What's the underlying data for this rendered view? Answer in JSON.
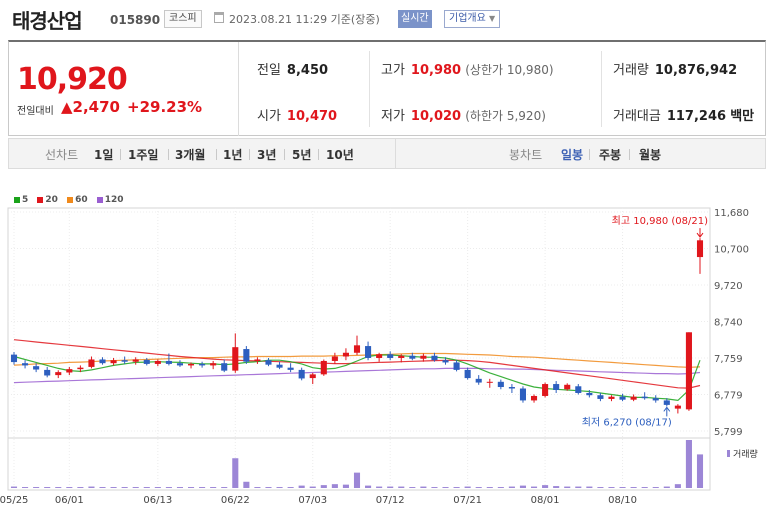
{
  "header": {
    "name": "태경산업",
    "code": "015890",
    "market": "코스피",
    "timestamp": "2023.08.21 11:29 기준(장중)",
    "realtime_button": "실시간",
    "company_button": "기업개요",
    "company_chevron": "▼"
  },
  "summary": {
    "price": "10,920",
    "change_label": "전일대비",
    "change_arrow": "▲",
    "change": "2,470",
    "change_pct": "+29.23%",
    "prev_label": "전일",
    "prev": "8,450",
    "open_label": "시가",
    "open": "10,470",
    "high_label": "고가",
    "high": "10,980",
    "high_sub": "(상한가 10,980)",
    "low_label": "저가",
    "low": "10,020",
    "low_sub": "(하한가 5,920)",
    "volume_label": "거래량",
    "volume": "10,876,942",
    "amount_label": "거래대금",
    "amount": "117,246",
    "amount_unit": "백만"
  },
  "periods": {
    "label": "선차트",
    "items": [
      "1일",
      "1주일",
      "3개월",
      "1년",
      "3년",
      "5년",
      "10년"
    ],
    "candle_label": "봉차트",
    "candle_items": [
      "일봉",
      "주봉",
      "월봉"
    ],
    "candle_selected": "일봉"
  },
  "legend": [
    {
      "label": "5",
      "color": "#1aa31a"
    },
    {
      "label": "20",
      "color": "#e0161c"
    },
    {
      "label": "60",
      "color": "#f08a1c"
    },
    {
      "label": "120",
      "color": "#9a5fd1"
    }
  ],
  "colors": {
    "up": "#e0161c",
    "down": "#2d5fbf",
    "volume": "#9c86d6"
  },
  "chart_data": {
    "type": "candlestick",
    "y_ticks": [
      "11,680",
      "10,700",
      "9,720",
      "8,740",
      "7,759",
      "6,779",
      "5,799"
    ],
    "ylim": [
      5799,
      11680
    ],
    "x_ticks": [
      {
        "label": "05/25",
        "index": 0
      },
      {
        "label": "06/01",
        "index": 5
      },
      {
        "label": "06/13",
        "index": 13
      },
      {
        "label": "06/22",
        "index": 20
      },
      {
        "label": "07/03",
        "index": 27
      },
      {
        "label": "07/12",
        "index": 34
      },
      {
        "label": "07/21",
        "index": 41
      },
      {
        "label": "08/01",
        "index": 48
      },
      {
        "label": "08/10",
        "index": 55
      }
    ],
    "annotation_high": "최고 10,980 (08/21)",
    "annotation_low": "최저 6,270 (08/17)",
    "volume_label": "거래량",
    "candles": [
      {
        "o": 7850,
        "h": 7920,
        "l": 7580,
        "c": 7650
      },
      {
        "o": 7620,
        "h": 7700,
        "l": 7480,
        "c": 7560
      },
      {
        "o": 7540,
        "h": 7620,
        "l": 7380,
        "c": 7450
      },
      {
        "o": 7440,
        "h": 7520,
        "l": 7240,
        "c": 7290
      },
      {
        "o": 7300,
        "h": 7430,
        "l": 7220,
        "c": 7380
      },
      {
        "o": 7370,
        "h": 7520,
        "l": 7300,
        "c": 7460
      },
      {
        "o": 7460,
        "h": 7560,
        "l": 7380,
        "c": 7500
      },
      {
        "o": 7520,
        "h": 7800,
        "l": 7480,
        "c": 7720
      },
      {
        "o": 7720,
        "h": 7780,
        "l": 7580,
        "c": 7620
      },
      {
        "o": 7620,
        "h": 7760,
        "l": 7560,
        "c": 7700
      },
      {
        "o": 7700,
        "h": 7800,
        "l": 7600,
        "c": 7660
      },
      {
        "o": 7660,
        "h": 7780,
        "l": 7580,
        "c": 7720
      },
      {
        "o": 7710,
        "h": 7760,
        "l": 7560,
        "c": 7600
      },
      {
        "o": 7600,
        "h": 7720,
        "l": 7540,
        "c": 7680
      },
      {
        "o": 7680,
        "h": 7880,
        "l": 7560,
        "c": 7600
      },
      {
        "o": 7620,
        "h": 7700,
        "l": 7520,
        "c": 7560
      },
      {
        "o": 7560,
        "h": 7640,
        "l": 7480,
        "c": 7600
      },
      {
        "o": 7600,
        "h": 7660,
        "l": 7500,
        "c": 7560
      },
      {
        "o": 7560,
        "h": 7680,
        "l": 7460,
        "c": 7620
      },
      {
        "o": 7620,
        "h": 7720,
        "l": 7380,
        "c": 7420
      },
      {
        "o": 7420,
        "h": 8420,
        "l": 7360,
        "c": 8050
      },
      {
        "o": 8000,
        "h": 8080,
        "l": 7600,
        "c": 7660
      },
      {
        "o": 7680,
        "h": 7780,
        "l": 7600,
        "c": 7720
      },
      {
        "o": 7700,
        "h": 7760,
        "l": 7540,
        "c": 7580
      },
      {
        "o": 7580,
        "h": 7660,
        "l": 7460,
        "c": 7500
      },
      {
        "o": 7500,
        "h": 7620,
        "l": 7380,
        "c": 7440
      },
      {
        "o": 7440,
        "h": 7500,
        "l": 7160,
        "c": 7210
      },
      {
        "o": 7220,
        "h": 7360,
        "l": 7060,
        "c": 7320
      },
      {
        "o": 7320,
        "h": 7720,
        "l": 7280,
        "c": 7680
      },
      {
        "o": 7680,
        "h": 7900,
        "l": 7600,
        "c": 7800
      },
      {
        "o": 7800,
        "h": 8020,
        "l": 7700,
        "c": 7900
      },
      {
        "o": 7900,
        "h": 8360,
        "l": 7840,
        "c": 8100
      },
      {
        "o": 8080,
        "h": 8200,
        "l": 7700,
        "c": 7760
      },
      {
        "o": 7760,
        "h": 7900,
        "l": 7660,
        "c": 7860
      },
      {
        "o": 7860,
        "h": 7940,
        "l": 7700,
        "c": 7760
      },
      {
        "o": 7760,
        "h": 7860,
        "l": 7640,
        "c": 7820
      },
      {
        "o": 7820,
        "h": 7900,
        "l": 7700,
        "c": 7740
      },
      {
        "o": 7740,
        "h": 7880,
        "l": 7660,
        "c": 7820
      },
      {
        "o": 7820,
        "h": 7900,
        "l": 7660,
        "c": 7700
      },
      {
        "o": 7700,
        "h": 7780,
        "l": 7580,
        "c": 7640
      },
      {
        "o": 7640,
        "h": 7700,
        "l": 7400,
        "c": 7440
      },
      {
        "o": 7440,
        "h": 7500,
        "l": 7180,
        "c": 7220
      },
      {
        "o": 7200,
        "h": 7300,
        "l": 7040,
        "c": 7100
      },
      {
        "o": 7100,
        "h": 7200,
        "l": 6960,
        "c": 7120
      },
      {
        "o": 7120,
        "h": 7180,
        "l": 6920,
        "c": 6980
      },
      {
        "o": 6980,
        "h": 7060,
        "l": 6820,
        "c": 6940
      },
      {
        "o": 6940,
        "h": 7000,
        "l": 6560,
        "c": 6620
      },
      {
        "o": 6620,
        "h": 6780,
        "l": 6560,
        "c": 6740
      },
      {
        "o": 6740,
        "h": 7100,
        "l": 6700,
        "c": 7060
      },
      {
        "o": 7060,
        "h": 7140,
        "l": 6820,
        "c": 6900
      },
      {
        "o": 6920,
        "h": 7080,
        "l": 6880,
        "c": 7040
      },
      {
        "o": 7000,
        "h": 7060,
        "l": 6780,
        "c": 6820
      },
      {
        "o": 6820,
        "h": 6900,
        "l": 6700,
        "c": 6760
      },
      {
        "o": 6760,
        "h": 6820,
        "l": 6600,
        "c": 6660
      },
      {
        "o": 6660,
        "h": 6760,
        "l": 6600,
        "c": 6720
      },
      {
        "o": 6720,
        "h": 6800,
        "l": 6600,
        "c": 6640
      },
      {
        "o": 6640,
        "h": 6780,
        "l": 6600,
        "c": 6720
      },
      {
        "o": 6720,
        "h": 6840,
        "l": 6640,
        "c": 6680
      },
      {
        "o": 6680,
        "h": 6760,
        "l": 6560,
        "c": 6620
      },
      {
        "o": 6620,
        "h": 6680,
        "l": 6460,
        "c": 6500
      },
      {
        "o": 6400,
        "h": 6520,
        "l": 6270,
        "c": 6480
      },
      {
        "o": 6380,
        "h": 8450,
        "l": 6340,
        "c": 8450
      },
      {
        "o": 10470,
        "h": 10980,
        "l": 10020,
        "c": 10920
      }
    ],
    "volumes": [
      0.03,
      0.02,
      0.02,
      0.02,
      0.02,
      0.02,
      0.02,
      0.03,
      0.02,
      0.02,
      0.02,
      0.02,
      0.02,
      0.02,
      0.02,
      0.02,
      0.02,
      0.02,
      0.02,
      0.02,
      0.62,
      0.13,
      0.02,
      0.02,
      0.02,
      0.02,
      0.05,
      0.03,
      0.06,
      0.08,
      0.07,
      0.32,
      0.05,
      0.03,
      0.03,
      0.03,
      0.02,
      0.03,
      0.02,
      0.02,
      0.02,
      0.03,
      0.02,
      0.02,
      0.02,
      0.03,
      0.05,
      0.03,
      0.06,
      0.04,
      0.03,
      0.03,
      0.03,
      0.02,
      0.02,
      0.02,
      0.02,
      0.02,
      0.02,
      0.03,
      0.08,
      1.0,
      0.7
    ],
    "ma": {
      "ma5": [
        7800,
        7720,
        7640,
        7560,
        7480,
        7420,
        7400,
        7440,
        7500,
        7560,
        7600,
        7640,
        7650,
        7660,
        7650,
        7640,
        7620,
        7600,
        7600,
        7580,
        7600,
        7640,
        7660,
        7700,
        7700,
        7660,
        7600,
        7500,
        7460,
        7480,
        7560,
        7680,
        7800,
        7840,
        7840,
        7820,
        7800,
        7780,
        7780,
        7760,
        7700,
        7600,
        7480,
        7360,
        7260,
        7160,
        7060,
        6980,
        6940,
        6920,
        6900,
        6880,
        6860,
        6820,
        6780,
        6740,
        6700,
        6700,
        6680,
        6660,
        6620,
        6900,
        7700
      ],
      "ma20": [
        8250,
        8220,
        8190,
        8160,
        8130,
        8100,
        8070,
        8040,
        8010,
        7980,
        7950,
        7920,
        7890,
        7860,
        7830,
        7800,
        7775,
        7750,
        7730,
        7710,
        7700,
        7690,
        7680,
        7670,
        7660,
        7650,
        7640,
        7630,
        7620,
        7610,
        7610,
        7620,
        7630,
        7640,
        7650,
        7660,
        7670,
        7680,
        7690,
        7695,
        7700,
        7690,
        7670,
        7640,
        7600,
        7560,
        7520,
        7480,
        7440,
        7400,
        7360,
        7320,
        7280,
        7240,
        7200,
        7160,
        7120,
        7080,
        7040,
        7000,
        6960,
        6950,
        7020
      ],
      "ma60": [
        7570,
        7580,
        7600,
        7610,
        7620,
        7640,
        7650,
        7660,
        7680,
        7690,
        7700,
        7710,
        7720,
        7730,
        7740,
        7750,
        7760,
        7770,
        7770,
        7780,
        7790,
        7790,
        7800,
        7800,
        7800,
        7800,
        7810,
        7810,
        7810,
        7820,
        7820,
        7830,
        7840,
        7850,
        7860,
        7870,
        7880,
        7880,
        7880,
        7880,
        7870,
        7860,
        7850,
        7840,
        7820,
        7800,
        7790,
        7780,
        7760,
        7740,
        7720,
        7700,
        7680,
        7660,
        7640,
        7620,
        7600,
        7580,
        7560,
        7540,
        7520,
        7510,
        7520
      ],
      "ma120": [
        7100,
        7110,
        7120,
        7130,
        7140,
        7150,
        7160,
        7170,
        7180,
        7190,
        7200,
        7210,
        7220,
        7230,
        7240,
        7250,
        7260,
        7270,
        7280,
        7290,
        7300,
        7310,
        7320,
        7330,
        7340,
        7350,
        7360,
        7370,
        7380,
        7390,
        7400,
        7410,
        7420,
        7430,
        7440,
        7450,
        7460,
        7470,
        7470,
        7480,
        7480,
        7480,
        7480,
        7470,
        7470,
        7460,
        7460,
        7450,
        7440,
        7430,
        7420,
        7410,
        7400,
        7390,
        7380,
        7370,
        7360,
        7350,
        7340,
        7340,
        7330,
        7340,
        7370
      ]
    }
  }
}
